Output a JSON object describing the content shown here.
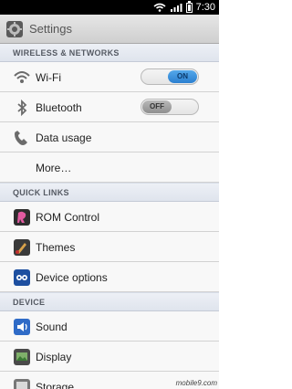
{
  "status_bar": {
    "time": "7:30",
    "icons": [
      "wifi-icon",
      "signal-icon",
      "battery-icon"
    ]
  },
  "action_bar": {
    "title": "Settings",
    "icon": "settings-app-icon"
  },
  "sections": [
    {
      "header": "WIRELESS & NETWORKS",
      "items": [
        {
          "label": "Wi-Fi",
          "icon": "wifi-icon",
          "toggle": "ON"
        },
        {
          "label": "Bluetooth",
          "icon": "bluetooth-icon",
          "toggle": "OFF"
        },
        {
          "label": "Data usage",
          "icon": "data-usage-icon"
        },
        {
          "label": "More…"
        }
      ]
    },
    {
      "header": "QUICK LINKS",
      "items": [
        {
          "label": "ROM Control",
          "icon": "rom-control-icon"
        },
        {
          "label": "Themes",
          "icon": "themes-icon"
        },
        {
          "label": "Device options",
          "icon": "device-options-icon"
        }
      ]
    },
    {
      "header": "DEVICE",
      "items": [
        {
          "label": "Sound",
          "icon": "sound-icon"
        },
        {
          "label": "Display",
          "icon": "display-icon"
        },
        {
          "label": "Storage",
          "icon": "storage-icon"
        }
      ]
    }
  ],
  "watermark": "mobile9.com",
  "colors": {
    "toggle_on": "#2a7fd0",
    "section_bg": "#d7dde7",
    "item_bg": "#f8f8f8"
  }
}
